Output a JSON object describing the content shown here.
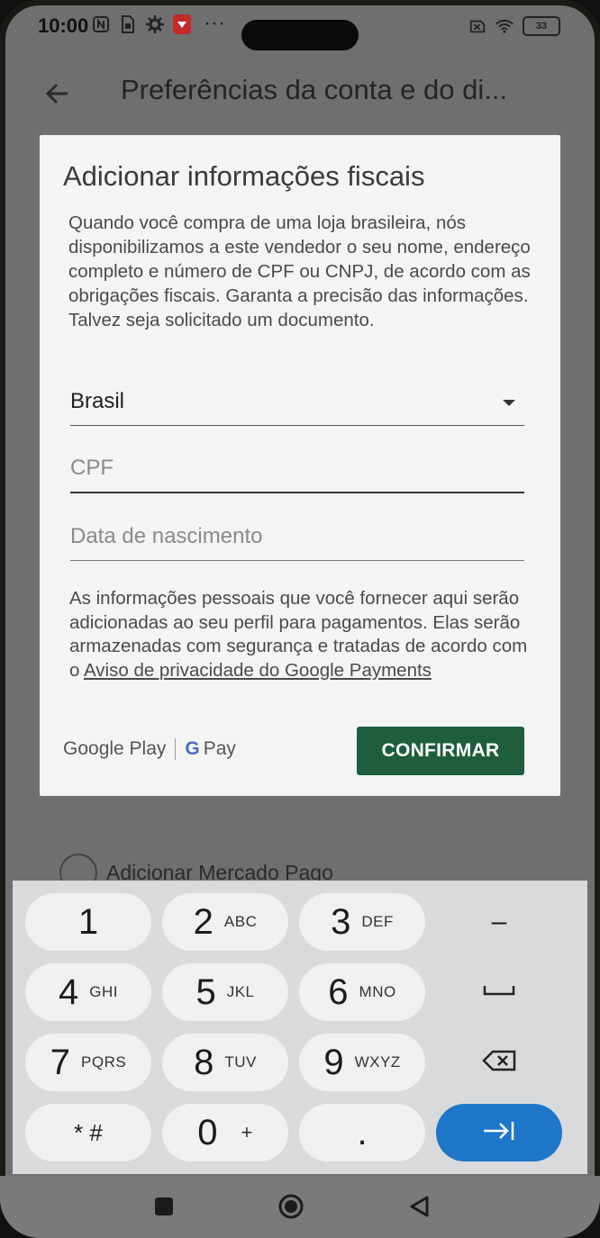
{
  "status_bar": {
    "time": "10:00",
    "dots": "···",
    "battery": "33",
    "icons": [
      "nfc-icon",
      "sim-icon",
      "gear-icon",
      "notification-app-icon",
      "sim-off-icon",
      "wifi-icon",
      "battery-icon"
    ]
  },
  "app_bar": {
    "title": "Preferências da conta e do di...",
    "back_icon": "arrow-left-icon"
  },
  "dialog": {
    "title": "Adicionar informações fiscais",
    "description": "Quando você compra de uma loja brasileira, nós disponibilizamos a este vendedor o seu nome, endereço completo e número de CPF ou CNPJ, de acordo com as obrigações fiscais. Garanta a precisão das informações. Talvez seja solicitado um documento.",
    "country_value": "Brasil",
    "cpf_placeholder": "CPF",
    "birthdate_placeholder": "Data de nascimento",
    "info_text": "As informações pessoais que você fornecer aqui serão adicionadas ao seu perfil para pagamentos. Elas serão armazenadas com segurança e tratadas de acordo com o",
    "info_link": "Aviso de privacidade do Google Payments",
    "brand_google_play": "Google Play",
    "brand_gpay": "Pay",
    "brand_g": "G",
    "confirm_label": "CONFIRMAR"
  },
  "behind": {
    "item_label": "Adicionar Mercado Pago"
  },
  "keyboard": {
    "keys": [
      {
        "digit": "1",
        "letters": ""
      },
      {
        "digit": "2",
        "letters": "ABC"
      },
      {
        "digit": "3",
        "letters": "DEF"
      },
      {
        "digit": "–",
        "letters": ""
      },
      {
        "digit": "4",
        "letters": "GHI"
      },
      {
        "digit": "5",
        "letters": "JKL"
      },
      {
        "digit": "6",
        "letters": "MNO"
      },
      {
        "digit": "␣",
        "letters": ""
      },
      {
        "digit": "7",
        "letters": "PQRS"
      },
      {
        "digit": "8",
        "letters": "TUV"
      },
      {
        "digit": "9",
        "letters": "WXYZ"
      },
      {
        "digit": "⌫",
        "letters": ""
      },
      {
        "digit": "* #",
        "letters": ""
      },
      {
        "digit": "0",
        "letters": "+"
      },
      {
        "digit": ".",
        "letters": ""
      },
      {
        "digit": "→|",
        "letters": ""
      }
    ]
  },
  "nav_bar": {
    "recents_icon": "square-icon",
    "home_icon": "circle-icon",
    "back_icon": "triangle-back-icon"
  },
  "colors": {
    "confirm_button": "#1e5e3f",
    "enter_key": "#1e76c9",
    "dim_background": "#6f6f6f"
  }
}
